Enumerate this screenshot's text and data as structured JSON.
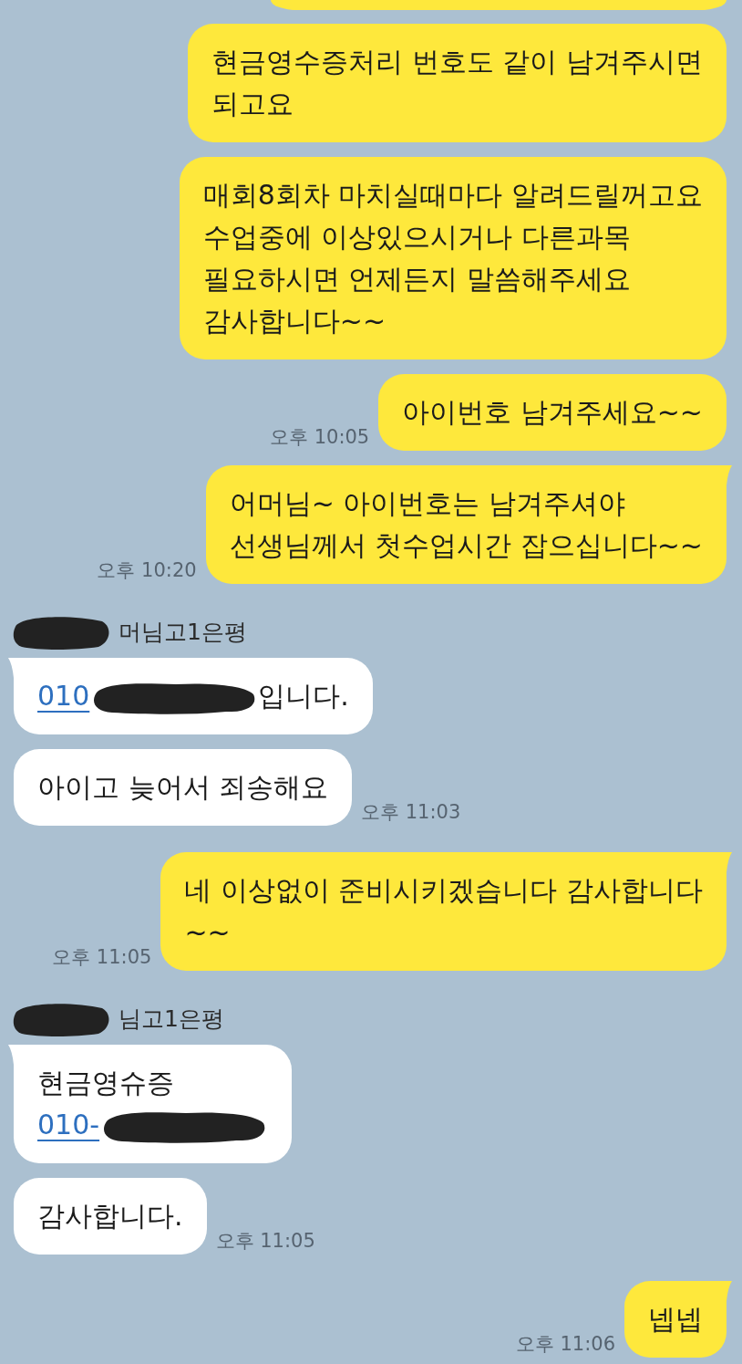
{
  "chat": {
    "items": [
      {
        "kind": "clipped",
        "sent": true
      },
      {
        "kind": "bubble",
        "sent": true,
        "tail": false,
        "text": "현금영수증처리 번호도 같이 남겨주시면\n되고요"
      },
      {
        "kind": "bubble",
        "sent": true,
        "tail": false,
        "text": "매회8회차 마치실때마다 알려드릴꺼고요\n수업중에 이상있으시거나 다른과목\n필요하시면 언제든지 말씀해주세요\n감사합니다~~"
      },
      {
        "kind": "bubble",
        "sent": true,
        "tail": false,
        "text": "아이번호 남겨주세요~~",
        "time": "오후 10:05"
      },
      {
        "kind": "bubble",
        "sent": true,
        "tail": true,
        "text": "어머님~ 아이번호는 남겨주셔야\n선생님께서 첫수업시간 잡으십니다~~",
        "time": "오후 10:20"
      },
      {
        "kind": "sender",
        "redacted": true,
        "name": "머님고1은평"
      },
      {
        "kind": "bubble",
        "sent": false,
        "tail": true,
        "segments": [
          {
            "kind": "link",
            "text": "010"
          },
          {
            "kind": "redacted"
          },
          {
            "kind": "text",
            "text": "입니다."
          }
        ]
      },
      {
        "kind": "bubble",
        "sent": false,
        "tail": false,
        "text": "아이고 늦어서 죄송해요",
        "time": "오후 11:03"
      },
      {
        "kind": "bubble",
        "sent": true,
        "tail": true,
        "text": "네 이상없이 준비시키겠습니다 감사합니다\n~~",
        "time": "오후 11:05"
      },
      {
        "kind": "sender",
        "redacted": true,
        "name": "님고1은평"
      },
      {
        "kind": "bubble",
        "sent": false,
        "tail": true,
        "segments": [
          {
            "kind": "text",
            "text": "현금영슈증"
          },
          {
            "kind": "break"
          },
          {
            "kind": "link",
            "text": "010-"
          },
          {
            "kind": "redacted"
          }
        ]
      },
      {
        "kind": "bubble",
        "sent": false,
        "tail": false,
        "text": "감사합니다.",
        "time": "오후 11:05"
      },
      {
        "kind": "bubble",
        "sent": true,
        "tail": true,
        "text": "넵넵",
        "time": "오후 11:06"
      }
    ]
  }
}
